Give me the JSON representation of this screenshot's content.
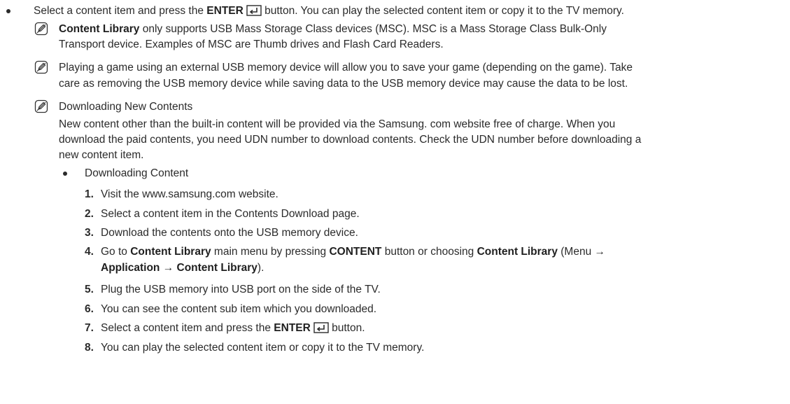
{
  "bullet1": {
    "pre": "Select a content item and press the ",
    "bold": "ENTER",
    "post": " button. You can play the selected content item or copy it to the TV memory."
  },
  "note1": {
    "bold": "Content Library",
    "l1": " only supports USB Mass Storage Class devices (MSC). MSC is a Mass Storage Class Bulk-Only",
    "l2": "Transport device. Examples of MSC are Thumb drives and Flash Card Readers."
  },
  "note2": {
    "l1": "Playing a game using an external USB memory device will allow you to save your game (depending on the game). Take",
    "l2": "care as removing the USB memory device while saving data to the USB memory device may cause the data to be lost."
  },
  "note3": {
    "title": "Downloading New Contents",
    "l1": "New content other than the built-in content will be provided via the Samsung. com website free of charge. When you",
    "l2": "download the paid contents, you need UDN number to download contents. Check the UDN number before downloading a",
    "l3": "new content item."
  },
  "sub_bullet": "Downloading Content",
  "steps": {
    "s1": {
      "n": "1.",
      "t": "Visit the www.samsung.com website."
    },
    "s2": {
      "n": "2.",
      "t": "Select a content item in the Contents Download page."
    },
    "s3": {
      "n": "3.",
      "t": "Download the contents onto the USB memory device."
    },
    "s4": {
      "n": "4.",
      "a": "Go to ",
      "b": "Content Library",
      "c": " main menu by pressing ",
      "d": "CONTENT",
      "e": " button or choosing ",
      "f": "Content Library",
      "g": " (Menu →",
      "h": "Application",
      "i": " → ",
      "j": "Content Library",
      "k": ")."
    },
    "s5": {
      "n": "5.",
      "t": "Plug the USB memory into USB port on the side of the TV."
    },
    "s6": {
      "n": "6.",
      "t": "You can see the content sub item which you downloaded."
    },
    "s7": {
      "n": "7.",
      "pre": "Select a content item and press the ",
      "bold": "ENTER",
      "post": " button."
    },
    "s8": {
      "n": "8.",
      "t": "You can play the selected content item or copy it to the TV memory."
    }
  }
}
